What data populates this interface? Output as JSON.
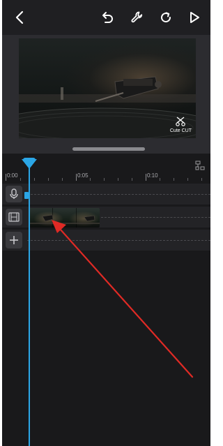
{
  "toolbar": {
    "icons": [
      "back-icon",
      "undo-icon",
      "wrench-icon",
      "redo-icon",
      "play-icon"
    ]
  },
  "preview": {
    "watermark_label": "Cute CUT"
  },
  "timeline": {
    "ruler_labels": [
      "0:00",
      "0:05",
      "0:10"
    ],
    "tracks": [
      "microphone-icon",
      "film-icon",
      "plus-icon"
    ],
    "playhead_color": "#2ba6e6"
  },
  "annotation": {
    "arrow_color": "#e02a25"
  }
}
